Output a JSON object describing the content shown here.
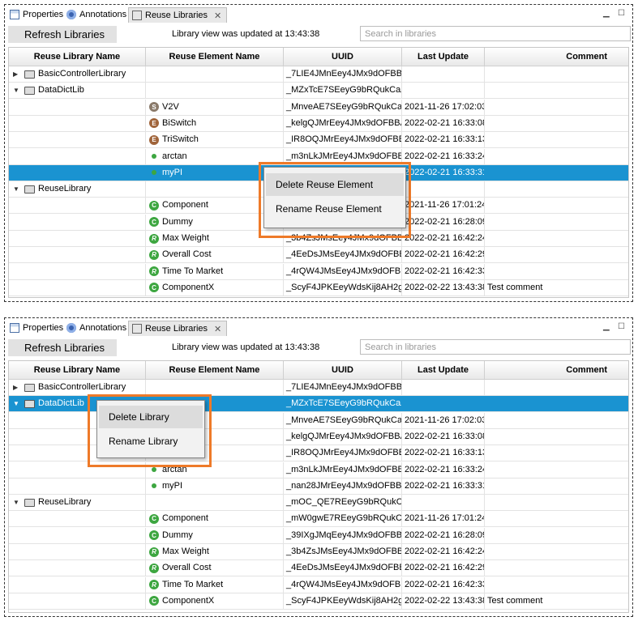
{
  "tabs": {
    "properties": "Properties",
    "annotations": "Annotations",
    "reuse_libraries": "Reuse Libraries"
  },
  "toolbar": {
    "refresh_label": "Refresh Libraries",
    "status": "Library view was updated at 13:43:38",
    "search_placeholder": "Search in libraries"
  },
  "columns": [
    "Reuse Library Name",
    "Reuse Element Name",
    "UUID",
    "Last Update",
    "Comment"
  ],
  "panel1": {
    "rows": [
      {
        "lib": "BasicControllerLibrary",
        "expand": "▶",
        "icon": "",
        "element": "",
        "uuid": "_7LIE4JMnEey4JMx9dOFBBA",
        "date": "",
        "comment": "",
        "selected": false
      },
      {
        "lib": "DataDictLib",
        "expand": "▼",
        "icon": "",
        "element": "",
        "uuid": "_MZxTcE7SEeyG9bRQukCaZw",
        "date": "",
        "comment": "",
        "selected": false
      },
      {
        "lib": "",
        "expand": "",
        "icon": "S",
        "element": "V2V",
        "uuid": "_MnveAE7SEeyG9bRQukCaZw",
        "date": "2021-11-26 17:02:03",
        "comment": "",
        "selected": false
      },
      {
        "lib": "",
        "expand": "",
        "icon": "E",
        "element": "BiSwitch",
        "uuid": "_kelgQJMrEey4JMx9dOFBBA",
        "date": "2022-02-21 16:33:08",
        "comment": "",
        "selected": false
      },
      {
        "lib": "",
        "expand": "",
        "icon": "E",
        "element": "TriSwitch",
        "uuid": "_IR8OQJMrEey4JMx9dOFBBA",
        "date": "2022-02-21 16:33:13",
        "comment": "",
        "selected": false
      },
      {
        "lib": "",
        "expand": "",
        "icon": "dot",
        "element": "arctan",
        "uuid": "_m3nLkJMrEey4JMx9dOFBBA",
        "date": "2022-02-21 16:33:24",
        "comment": "",
        "selected": false
      },
      {
        "lib": "",
        "expand": "",
        "icon": "dot",
        "element": "myPI",
        "uuid": "",
        "date": "2022-02-21 16:33:31",
        "comment": "",
        "selected": true
      },
      {
        "lib": "ReuseLibrary",
        "expand": "▼",
        "icon": "",
        "element": "",
        "uuid": "",
        "date": "",
        "comment": "",
        "selected": false
      },
      {
        "lib": "",
        "expand": "",
        "icon": "C",
        "element": "Component",
        "uuid": "",
        "date": "2021-11-26 17:01:24",
        "comment": "",
        "selected": false
      },
      {
        "lib": "",
        "expand": "",
        "icon": "C",
        "element": "Dummy",
        "uuid": "",
        "date": "2022-02-21 16:28:09",
        "comment": "",
        "selected": false
      },
      {
        "lib": "",
        "expand": "",
        "icon": "R",
        "element": "Max Weight",
        "uuid": "_3b4ZsJMsEey4JMx9dOFBBA",
        "date": "2022-02-21 16:42:24",
        "comment": "",
        "selected": false
      },
      {
        "lib": "",
        "expand": "",
        "icon": "R",
        "element": "Overall Cost",
        "uuid": "_4EeDsJMsEey4JMx9dOFBBA",
        "date": "2022-02-21 16:42:29",
        "comment": "",
        "selected": false
      },
      {
        "lib": "",
        "expand": "",
        "icon": "R",
        "element": "Time To Market",
        "uuid": "_4rQW4JMsEey4JMx9dOFBBA",
        "date": "2022-02-21 16:42:33",
        "comment": "",
        "selected": false
      },
      {
        "lib": "",
        "expand": "",
        "icon": "C",
        "element": "ComponentX",
        "uuid": "_ScyF4JPKEeyWdsKij8AH2g",
        "date": "2022-02-22 13:43:38",
        "comment": "Test comment",
        "selected": false
      }
    ],
    "menu": [
      "Delete Reuse Element",
      "Rename Reuse Element"
    ]
  },
  "panel2": {
    "rows": [
      {
        "lib": "BasicControllerLibrary",
        "expand": "▶",
        "icon": "",
        "element": "",
        "uuid": "_7LIE4JMnEey4JMx9dOFBBA",
        "date": "",
        "comment": "",
        "selected": false
      },
      {
        "lib": "DataDictLib",
        "expand": "▼",
        "icon": "",
        "element": "",
        "uuid": "_MZxTcE7SEeyG9bRQukCaZw",
        "date": "",
        "comment": "",
        "selected": true
      },
      {
        "lib": "",
        "expand": "",
        "icon": "",
        "element": "",
        "uuid": "_MnveAE7SEeyG9bRQukCaZw",
        "date": "2021-11-26 17:02:03",
        "comment": "",
        "selected": false
      },
      {
        "lib": "",
        "expand": "",
        "icon": "",
        "element": "",
        "uuid": "_kelgQJMrEey4JMx9dOFBBA",
        "date": "2022-02-21 16:33:08",
        "comment": "",
        "selected": false
      },
      {
        "lib": "",
        "expand": "",
        "icon": "",
        "element": "",
        "uuid": "_IR8OQJMrEey4JMx9dOFBBA",
        "date": "2022-02-21 16:33:13",
        "comment": "",
        "selected": false
      },
      {
        "lib": "",
        "expand": "",
        "icon": "dot",
        "element": "arctan",
        "uuid": "_m3nLkJMrEey4JMx9dOFBBA",
        "date": "2022-02-21 16:33:24",
        "comment": "",
        "selected": false
      },
      {
        "lib": "",
        "expand": "",
        "icon": "dot",
        "element": "myPI",
        "uuid": "_nan28JMrEey4JMx9dOFBBA",
        "date": "2022-02-21 16:33:31",
        "comment": "",
        "selected": false
      },
      {
        "lib": "ReuseLibrary",
        "expand": "▼",
        "icon": "",
        "element": "",
        "uuid": "_mOC_QE7REeyG9bRQukCaZw",
        "date": "",
        "comment": "",
        "selected": false
      },
      {
        "lib": "",
        "expand": "",
        "icon": "C",
        "element": "Component",
        "uuid": "_mW0gwE7REeyG9bRQukCa...",
        "date": "2021-11-26 17:01:24",
        "comment": "",
        "selected": false
      },
      {
        "lib": "",
        "expand": "",
        "icon": "C",
        "element": "Dummy",
        "uuid": "_39IXgJMqEey4JMx9dOFBBA",
        "date": "2022-02-21 16:28:09",
        "comment": "",
        "selected": false
      },
      {
        "lib": "",
        "expand": "",
        "icon": "R",
        "element": "Max Weight",
        "uuid": "_3b4ZsJMsEey4JMx9dOFBBA",
        "date": "2022-02-21 16:42:24",
        "comment": "",
        "selected": false
      },
      {
        "lib": "",
        "expand": "",
        "icon": "R",
        "element": "Overall Cost",
        "uuid": "_4EeDsJMsEey4JMx9dOFBBA",
        "date": "2022-02-21 16:42:29",
        "comment": "",
        "selected": false
      },
      {
        "lib": "",
        "expand": "",
        "icon": "R",
        "element": "Time To Market",
        "uuid": "_4rQW4JMsEey4JMx9dOFBBA",
        "date": "2022-02-21 16:42:33",
        "comment": "",
        "selected": false
      },
      {
        "lib": "",
        "expand": "",
        "icon": "C",
        "element": "ComponentX",
        "uuid": "_ScyF4JPKEeyWdsKij8AH2g",
        "date": "2022-02-22 13:43:38",
        "comment": "Test comment",
        "selected": false
      }
    ],
    "menu": [
      "Delete Library",
      "Rename Library"
    ]
  },
  "colors": {
    "selection": "#1a93d1",
    "highlight_border": "#ee7a29"
  }
}
